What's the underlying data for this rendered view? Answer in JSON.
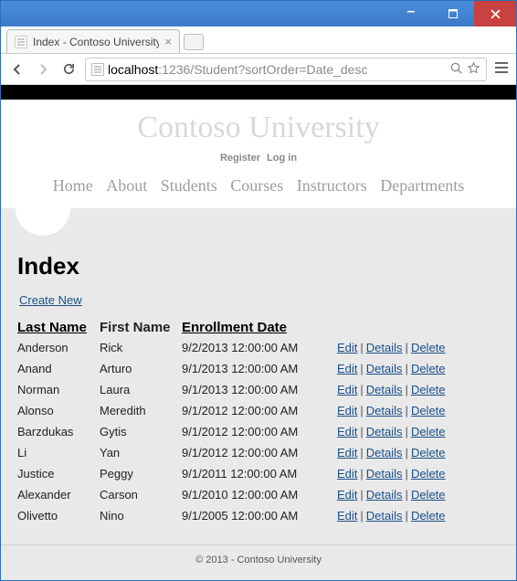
{
  "window": {
    "tab_title": "Index - Contoso University"
  },
  "browser": {
    "url_host": "localhost",
    "url_rest": ":1236/Student?sortOrder=Date_desc"
  },
  "site": {
    "logo": "Contoso University",
    "register": "Register",
    "login": "Log in",
    "nav": {
      "home": "Home",
      "about": "About",
      "students": "Students",
      "courses": "Courses",
      "instructors": "Instructors",
      "departments": "Departments"
    }
  },
  "page": {
    "heading": "Index",
    "create": "Create New",
    "headers": {
      "last": "Last Name",
      "first": "First Name",
      "enroll": "Enrollment Date"
    },
    "action_labels": {
      "edit": "Edit",
      "details": "Details",
      "delete": "Delete"
    },
    "rows": [
      {
        "last": "Anderson",
        "first": "Rick",
        "date": "9/2/2013 12:00:00 AM"
      },
      {
        "last": "Anand",
        "first": "Arturo",
        "date": "9/1/2013 12:00:00 AM"
      },
      {
        "last": "Norman",
        "first": "Laura",
        "date": "9/1/2013 12:00:00 AM"
      },
      {
        "last": "Alonso",
        "first": "Meredith",
        "date": "9/1/2012 12:00:00 AM"
      },
      {
        "last": "Barzdukas",
        "first": "Gytis",
        "date": "9/1/2012 12:00:00 AM"
      },
      {
        "last": "Li",
        "first": "Yan",
        "date": "9/1/2012 12:00:00 AM"
      },
      {
        "last": "Justice",
        "first": "Peggy",
        "date": "9/1/2011 12:00:00 AM"
      },
      {
        "last": "Alexander",
        "first": "Carson",
        "date": "9/1/2010 12:00:00 AM"
      },
      {
        "last": "Olivetto",
        "first": "Nino",
        "date": "9/1/2005 12:00:00 AM"
      }
    ]
  },
  "footer": {
    "text": "© 2013 - Contoso University"
  }
}
